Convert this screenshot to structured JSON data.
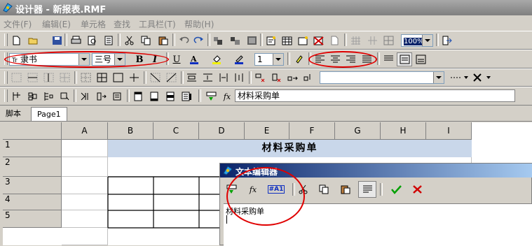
{
  "window": {
    "title": "设计器 - 新报表.RMF"
  },
  "menu": [
    "文件(F)",
    "编辑(E)",
    "单元格",
    "查找",
    "工具栏(T)",
    "帮助(H)"
  ],
  "toolbar1": {
    "zoom": "100%"
  },
  "toolbar2": {
    "font": "隶书",
    "size": "三号",
    "line_width": "1",
    "bold": "B",
    "italic": "I",
    "underline": "U",
    "font_prefix": "Tr"
  },
  "toolbar4": {
    "fx": "fx",
    "formula_value": "材料采购单"
  },
  "tabs": [
    "脚本",
    "Page1"
  ],
  "sheet": {
    "columns": [
      "A",
      "B",
      "C",
      "D",
      "E",
      "F",
      "G",
      "H",
      "I"
    ],
    "rows": [
      "1",
      "2",
      "3",
      "4",
      "5"
    ],
    "title_cell": "材料采购单"
  },
  "editor": {
    "title": "文本编辑器",
    "fx": "fx",
    "field_btn": "#A1",
    "content": "材料采购单"
  },
  "colors": {
    "highlight_oval": "#e00000",
    "title_cell_bg": "#c9d7ea",
    "editor_title": "#0a246a",
    "ok": "#00a000",
    "cancel": "#d00000"
  }
}
